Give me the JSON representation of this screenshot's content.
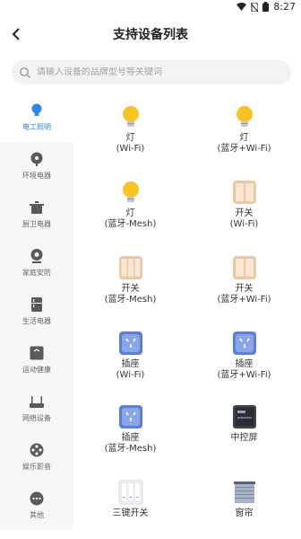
{
  "status_bar": {
    "time": "8:27"
  },
  "header": {
    "title": "支持设备列表"
  },
  "search": {
    "placeholder": "请输入设备的品牌型号等关键词"
  },
  "sidebar": {
    "items": [
      {
        "label": "电工照明",
        "icon": "bulb-icon",
        "active": true
      },
      {
        "label": "环境电器",
        "icon": "fan-icon"
      },
      {
        "label": "厨卫电器",
        "icon": "pot-icon"
      },
      {
        "label": "家庭安防",
        "icon": "camera-icon"
      },
      {
        "label": "生活电器",
        "icon": "fridge-icon"
      },
      {
        "label": "运动健康",
        "icon": "scale-icon"
      },
      {
        "label": "网络设备",
        "icon": "router-icon"
      },
      {
        "label": "娱乐影音",
        "icon": "film-icon"
      },
      {
        "label": "其他",
        "icon": "more-icon"
      }
    ]
  },
  "devices": [
    {
      "name": "灯",
      "sub": "(Wi-Fi)",
      "icon": "bulb-icon"
    },
    {
      "name": "灯",
      "sub": "(蓝牙+Wi-Fi)",
      "icon": "bulb-icon"
    },
    {
      "name": "灯",
      "sub": "(蓝牙-Mesh)",
      "icon": "bulb-icon"
    },
    {
      "name": "开关",
      "sub": "(Wi-Fi)",
      "icon": "switch-icon"
    },
    {
      "name": "开关",
      "sub": "(蓝牙-Mesh)",
      "icon": "switch-icon"
    },
    {
      "name": "开关",
      "sub": "(蓝牙+Wi-Fi)",
      "icon": "switch-icon"
    },
    {
      "name": "插座",
      "sub": "(Wi-Fi)",
      "icon": "socket-icon"
    },
    {
      "name": "插座",
      "sub": "(蓝牙+Wi-Fi)",
      "icon": "socket-icon"
    },
    {
      "name": "插座",
      "sub": "(蓝牙-Mesh)",
      "icon": "socket-icon"
    },
    {
      "name": "中控屏",
      "sub": "",
      "icon": "panel-icon"
    },
    {
      "name": "三键开关",
      "sub": "",
      "icon": "triple-switch-icon"
    },
    {
      "name": "窗帘",
      "sub": "",
      "icon": "curtain-icon"
    }
  ],
  "colors": {
    "accent": "#2e86e6",
    "bulb": "#f7c325",
    "switch": "#e8c9a6",
    "socket": "#5b7fd6"
  }
}
